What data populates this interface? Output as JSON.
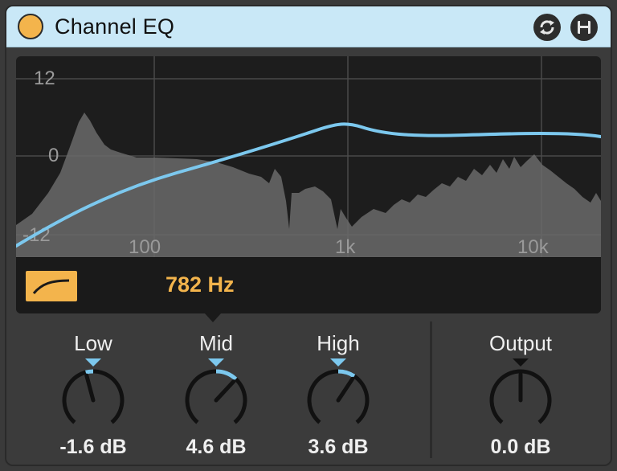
{
  "device": {
    "title": "Channel EQ",
    "power_on": true,
    "accent": "#f3b44c",
    "curve_color": "#7cc8ee"
  },
  "header": {
    "buttons": [
      {
        "icon": "hot-swap-icon"
      },
      {
        "icon": "save-preset-icon"
      }
    ]
  },
  "graph": {
    "y_ticks": [
      "12",
      "0",
      "-12"
    ],
    "x_ticks": [
      "100",
      "1k",
      "10k"
    ]
  },
  "info": {
    "filter_icon": "highpass-shape-icon",
    "frequency": "782 Hz"
  },
  "knobs": [
    {
      "id": "low",
      "label": "Low",
      "value": "-1.6 dB",
      "amount": -1.6
    },
    {
      "id": "mid",
      "label": "Mid",
      "value": "4.6 dB",
      "amount": 4.6
    },
    {
      "id": "high",
      "label": "High",
      "value": "3.6 dB",
      "amount": 3.6
    },
    {
      "id": "output",
      "label": "Output",
      "value": "0.0 dB",
      "amount": 0.0
    }
  ]
}
